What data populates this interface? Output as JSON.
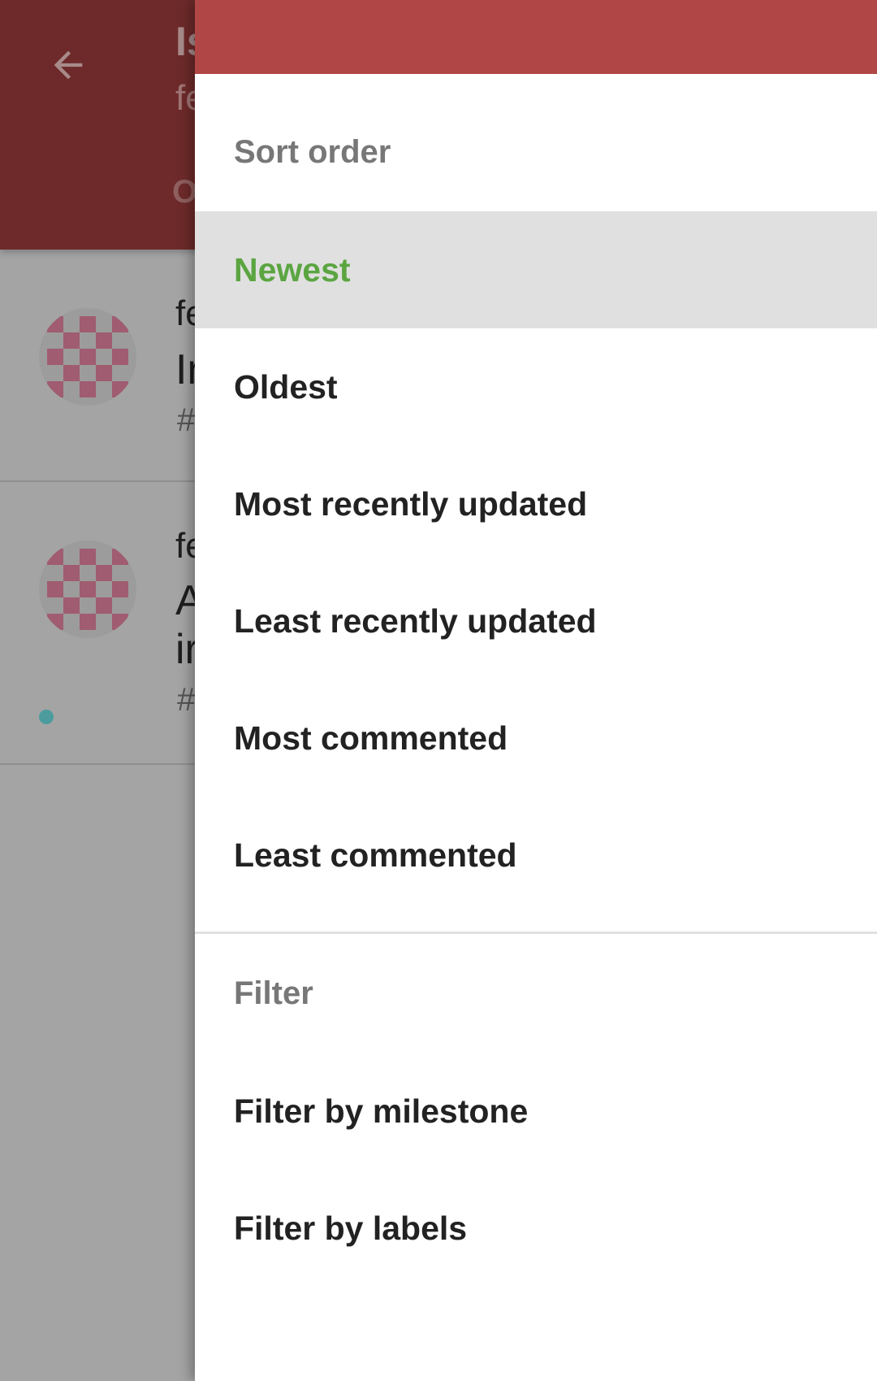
{
  "background": {
    "app_title": "Is",
    "app_subtitle": "fe",
    "active_tab": "O",
    "rows": [
      {
        "author": "fe",
        "title": "Ir",
        "number": "#"
      },
      {
        "author": "fe",
        "title": "A",
        "title_line2": "ir",
        "number": "#"
      }
    ]
  },
  "drawer": {
    "sort_section": {
      "header": "Sort order",
      "items": [
        {
          "label": "Newest",
          "selected": true
        },
        {
          "label": "Oldest"
        },
        {
          "label": "Most recently updated"
        },
        {
          "label": "Least recently updated"
        },
        {
          "label": "Most commented"
        },
        {
          "label": "Least commented"
        }
      ]
    },
    "filter_section": {
      "header": "Filter",
      "items": [
        {
          "label": "Filter by milestone"
        },
        {
          "label": "Filter by labels"
        }
      ]
    }
  },
  "colors": {
    "appbar_dimmed": "#6e2a2a",
    "drawer_header": "#b04646",
    "selected_text": "#5ba541",
    "selected_background": "#e0e0e0",
    "scrim": "#a4a4a4",
    "unread_dot": "#4c9c9e"
  },
  "icons": {
    "back": "arrow-left-icon",
    "avatar": "identicon-avatar-icon"
  }
}
